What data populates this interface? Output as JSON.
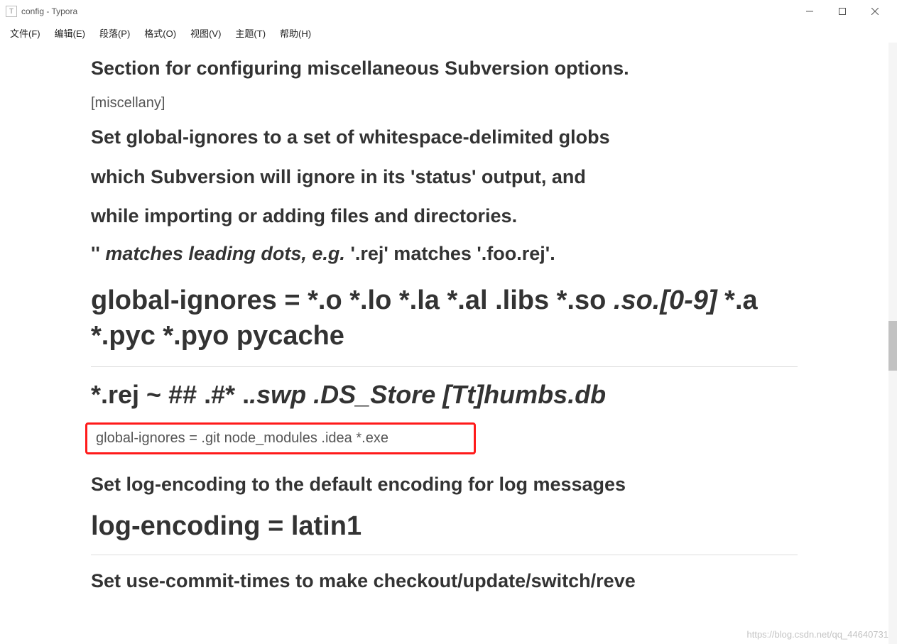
{
  "window": {
    "title": "config - Typora",
    "icon_letter": "T"
  },
  "menu": {
    "file": "文件(F)",
    "edit": "编辑(E)",
    "paragraph": "段落(P)",
    "format": "格式(O)",
    "view": "视图(V)",
    "theme": "主题(T)",
    "help": "帮助(H)"
  },
  "doc": {
    "line1": "Section for configuring miscellaneous Subversion options.",
    "line2": "[miscellany]",
    "line3": "Set global-ignores to a set of whitespace-delimited globs",
    "line4": "which Subversion will ignore in its 'status' output, and",
    "line5": "while importing or adding files and directories.",
    "line6_a": "'' ",
    "line6_b": "matches leading dots, e.g.",
    "line6_c": " '.rej' matches '.foo.rej'.",
    "line7_a": "global-ignores = *.o *.lo *.la *.al .libs *.so ",
    "line7_b": ".so.[0-9]",
    "line7_c": " *.a *.pyc *.pyo pycache",
    "line8_a": "*.rej ~ ## .#* .",
    "line8_b": ".swp .DS_Store [Tt]humbs.db",
    "line9": "global-ignores = .git node_modules .idea *.exe",
    "line10": "Set log-encoding to the default encoding for log messages",
    "line11": "log-encoding = latin1",
    "line12": "Set use-commit-times to make checkout/update/switch/reve"
  },
  "watermark": "https://blog.csdn.net/qq_44640731"
}
